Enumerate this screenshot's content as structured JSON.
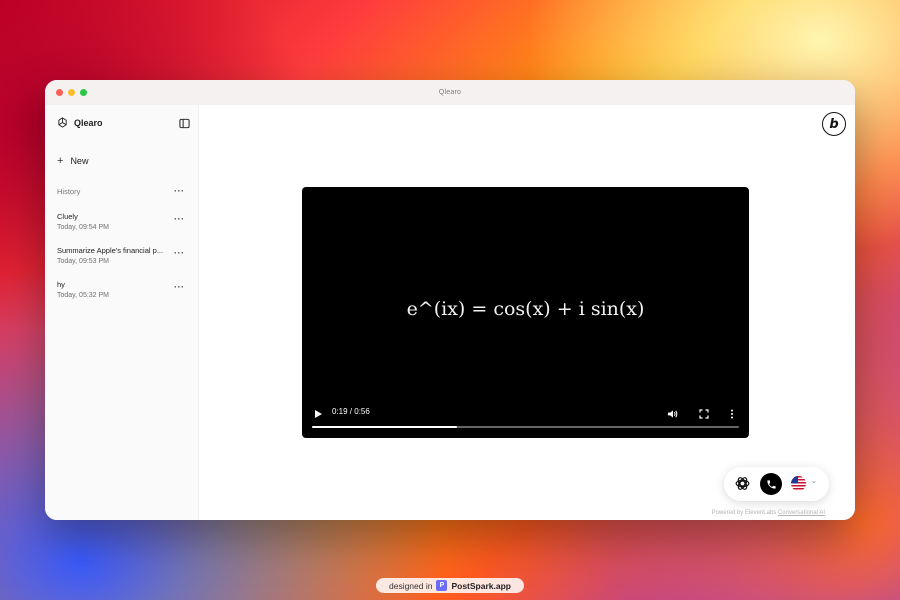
{
  "window": {
    "title": "Qlearo"
  },
  "sidebar": {
    "brand": "Qlearo",
    "new_label": "New",
    "history_label": "History",
    "history": [
      {
        "title": "Cluely",
        "time": "Today, 09:54 PM"
      },
      {
        "title": "Summarize Apple's financial p...",
        "time": "Today, 09:53 PM"
      },
      {
        "title": "hy",
        "time": "Today, 05:32 PM"
      }
    ]
  },
  "main": {
    "badge_letter": "b",
    "video": {
      "formula": "e^(ix) = cos(x) + i sin(x)",
      "timecode": "0:19 / 0:56",
      "progress": 0.34
    },
    "powered_prefix": "Powered by ElevenLabs ",
    "powered_link": "Conversational AI"
  },
  "footer": {
    "prefix": "designed in",
    "brand": "PostSpark.app"
  },
  "colors": {
    "accent": "#000000",
    "sidebar_bg": "#fafafa"
  }
}
